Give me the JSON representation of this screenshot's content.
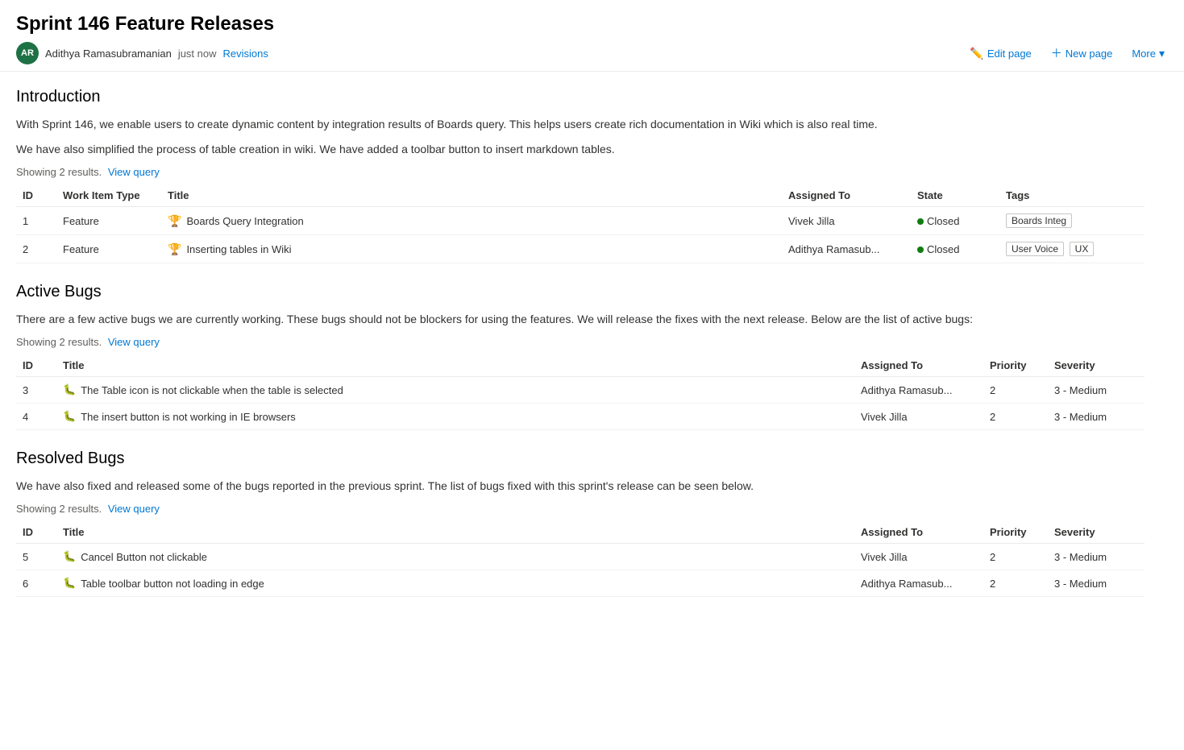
{
  "page": {
    "title": "Sprint 146 Feature Releases",
    "author": {
      "initials": "AR",
      "name": "Adithya Ramasubramanian",
      "avatar_color": "#1e7145"
    },
    "timestamp": "just now",
    "revisions_label": "Revisions"
  },
  "toolbar": {
    "edit_label": "Edit page",
    "new_label": "New page",
    "more_label": "More"
  },
  "sections": [
    {
      "id": "intro",
      "title": "Introduction",
      "paragraphs": [
        "With Sprint 146, we enable users to create dynamic content by integration results of Boards query. This helps users create rich documentation in Wiki which is also real time.",
        "We have also simplified the process of table creation in wiki. We have added a toolbar button to insert markdown tables."
      ],
      "results_text": "Showing 2 results.",
      "view_query_label": "View query",
      "columns": [
        "ID",
        "Work Item Type",
        "Title",
        "Assigned To",
        "State",
        "Tags"
      ],
      "rows": [
        {
          "id": "1",
          "type": "Feature",
          "type_icon": "feature",
          "title": "Boards Query Integration",
          "assigned_to": "Vivek Jilla",
          "state": "Closed",
          "state_type": "closed",
          "tags": [
            "Boards Integ"
          ]
        },
        {
          "id": "2",
          "type": "Feature",
          "type_icon": "feature",
          "title": "Inserting tables in Wiki",
          "assigned_to": "Adithya Ramasub...",
          "state": "Closed",
          "state_type": "closed",
          "tags": [
            "User Voice",
            "UX"
          ]
        }
      ]
    },
    {
      "id": "active-bugs",
      "title": "Active Bugs",
      "paragraphs": [
        "There are a few active bugs we are currently working. These bugs should not be blockers for using the features. We will release the fixes with the next release. Below are the list of active bugs:"
      ],
      "results_text": "Showing 2 results.",
      "view_query_label": "View query",
      "columns": [
        "ID",
        "Title",
        "Assigned To",
        "Priority",
        "Severity"
      ],
      "rows": [
        {
          "id": "3",
          "type_icon": "bug",
          "title": "The Table icon is not clickable when the table is selected",
          "assigned_to": "Adithya Ramasub...",
          "priority": "2",
          "severity": "3 - Medium"
        },
        {
          "id": "4",
          "type_icon": "bug",
          "title": "The insert button is not working in IE browsers",
          "assigned_to": "Vivek Jilla",
          "priority": "2",
          "severity": "3 - Medium"
        }
      ]
    },
    {
      "id": "resolved-bugs",
      "title": "Resolved Bugs",
      "paragraphs": [
        "We have also fixed and released some of the bugs reported in the previous sprint. The list of bugs fixed with this sprint's release can be seen below."
      ],
      "results_text": "Showing 2 results.",
      "view_query_label": "View query",
      "columns": [
        "ID",
        "Title",
        "Assigned To",
        "Priority",
        "Severity"
      ],
      "rows": [
        {
          "id": "5",
          "type_icon": "bug",
          "title": "Cancel Button not clickable",
          "assigned_to": "Vivek Jilla",
          "priority": "2",
          "severity": "3 - Medium"
        },
        {
          "id": "6",
          "type_icon": "bug",
          "title": "Table toolbar button not loading in edge",
          "assigned_to": "Adithya Ramasub...",
          "priority": "2",
          "severity": "3 - Medium"
        }
      ]
    }
  ]
}
